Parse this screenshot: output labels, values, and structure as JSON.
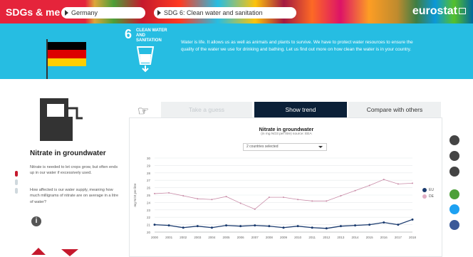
{
  "header": {
    "logo": "SDGs & me",
    "country_select": "Germany",
    "goal_select": "SDG 6: Clean water and sanitation",
    "brand": "eurostat"
  },
  "banner": {
    "goal_number": "6",
    "goal_title": "CLEAN WATER AND SANITATION",
    "text": "Water is life. It allows us as well as animals and plants to survive. We have to protect water resources to ensure the quality of the water we use for drinking and bathing. Let us find out more on how clean the water is in your country.",
    "flag_colors": [
      "#000000",
      "#dd0000",
      "#ffce00"
    ],
    "accent": "#26bde2"
  },
  "indicator": {
    "title": "Nitrate in groundwater",
    "description": "Nitrate is needed to let crops grow, but often ends up in our water if excessively used.",
    "question": "How affected is our water supply, meaning how much milligrams of nitrate are on average in a litre of water?"
  },
  "tabs": {
    "guess": "Take a guess",
    "trend": "Show trend",
    "compare": "Compare with others"
  },
  "chart_data": {
    "type": "line",
    "title": "Nitrate in groundwater",
    "subtitle": "(in mg NO3 per litre) source: EEA",
    "dropdown": "2 countries selected",
    "ylabel": "mg NO3 per litre",
    "ylim": [
      20,
      30
    ],
    "yticks": [
      20,
      21,
      22,
      23,
      24,
      25,
      26,
      27,
      28,
      29,
      30
    ],
    "x": [
      "2000",
      "2001",
      "2002",
      "2003",
      "2004",
      "2005",
      "2006",
      "2007",
      "2008",
      "2009",
      "2010",
      "2011",
      "2012",
      "2013",
      "2014",
      "2015",
      "2016",
      "2017",
      "2018"
    ],
    "series": [
      {
        "name": "EU",
        "color": "#1a3a6e",
        "values": [
          21.0,
          20.9,
          20.6,
          20.8,
          20.6,
          20.9,
          20.8,
          20.9,
          20.8,
          20.6,
          20.8,
          20.6,
          20.5,
          20.8,
          20.9,
          21.0,
          21.3,
          21.0,
          21.7
        ]
      },
      {
        "name": "DE",
        "color": "#c98ca8",
        "values": [
          25.2,
          25.3,
          24.9,
          24.5,
          24.4,
          24.8,
          23.9,
          23.1,
          24.7,
          24.7,
          24.4,
          24.2,
          24.2,
          24.9,
          25.6,
          26.3,
          27.1,
          26.5,
          26.6
        ]
      }
    ]
  },
  "icons": [
    "share-icon",
    "robot-icon",
    "globe-icon",
    "embed-icon",
    "twitter-icon",
    "facebook-icon"
  ]
}
